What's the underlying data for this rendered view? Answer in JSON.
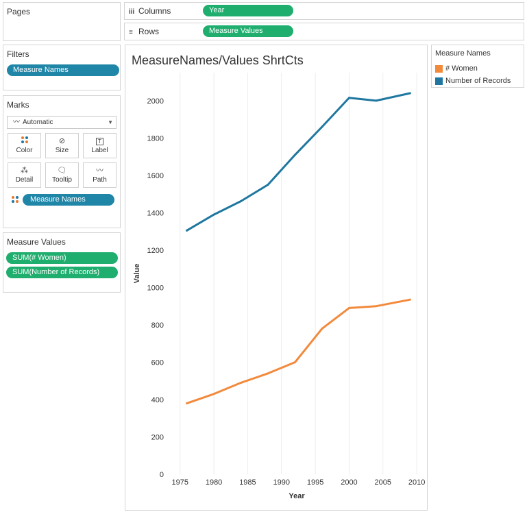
{
  "sidebar": {
    "pages_title": "Pages",
    "filters_title": "Filters",
    "filters_pill": "Measure Names",
    "marks_title": "Marks",
    "marks_type": "Automatic",
    "mark_buttons": [
      "Color",
      "Size",
      "Label",
      "Detail",
      "Tooltip",
      "Path"
    ],
    "marks_pill": "Measure Names",
    "measure_values_title": "Measure Values",
    "measure_values_pills": [
      "SUM(# Women)",
      "SUM(Number of Records)"
    ]
  },
  "shelves": {
    "columns_label": "Columns",
    "columns_pill": "Year",
    "rows_label": "Rows",
    "rows_pill": "Measure Values"
  },
  "legend": {
    "title": "Measure Names",
    "items": [
      {
        "label": "# Women",
        "color": "#f28a3c"
      },
      {
        "label": "Number of Records",
        "color": "#1f77a0"
      }
    ]
  },
  "colors": {
    "pill_blue": "#1f86a8",
    "pill_green": "#1fae6e"
  },
  "chart_data": {
    "type": "line",
    "title": "MeasureNames/Values ShrtCts",
    "xlabel": "Year",
    "ylabel": "Value",
    "xlim": [
      1973,
      2011
    ],
    "ylim": [
      0,
      2150
    ],
    "xticks": [
      1975,
      1980,
      1985,
      1990,
      1995,
      2000,
      2005,
      2010
    ],
    "yticks": [
      0,
      200,
      400,
      600,
      800,
      1000,
      1200,
      1400,
      1600,
      1800,
      2000
    ],
    "grid": "vertical",
    "legend": "right",
    "series": [
      {
        "name": "# Women",
        "color": "#f28a3c",
        "x": [
          1976,
          1980,
          1984,
          1988,
          1992,
          1996,
          2000,
          2004,
          2009
        ],
        "y": [
          380,
          430,
          490,
          540,
          600,
          780,
          890,
          900,
          935
        ]
      },
      {
        "name": "Number of Records",
        "color": "#1f77a0",
        "x": [
          1976,
          1980,
          1984,
          1988,
          1992,
          1996,
          2000,
          2004,
          2009
        ],
        "y": [
          1305,
          1390,
          1462,
          1550,
          1710,
          1860,
          2015,
          2000,
          2040
        ]
      }
    ]
  }
}
